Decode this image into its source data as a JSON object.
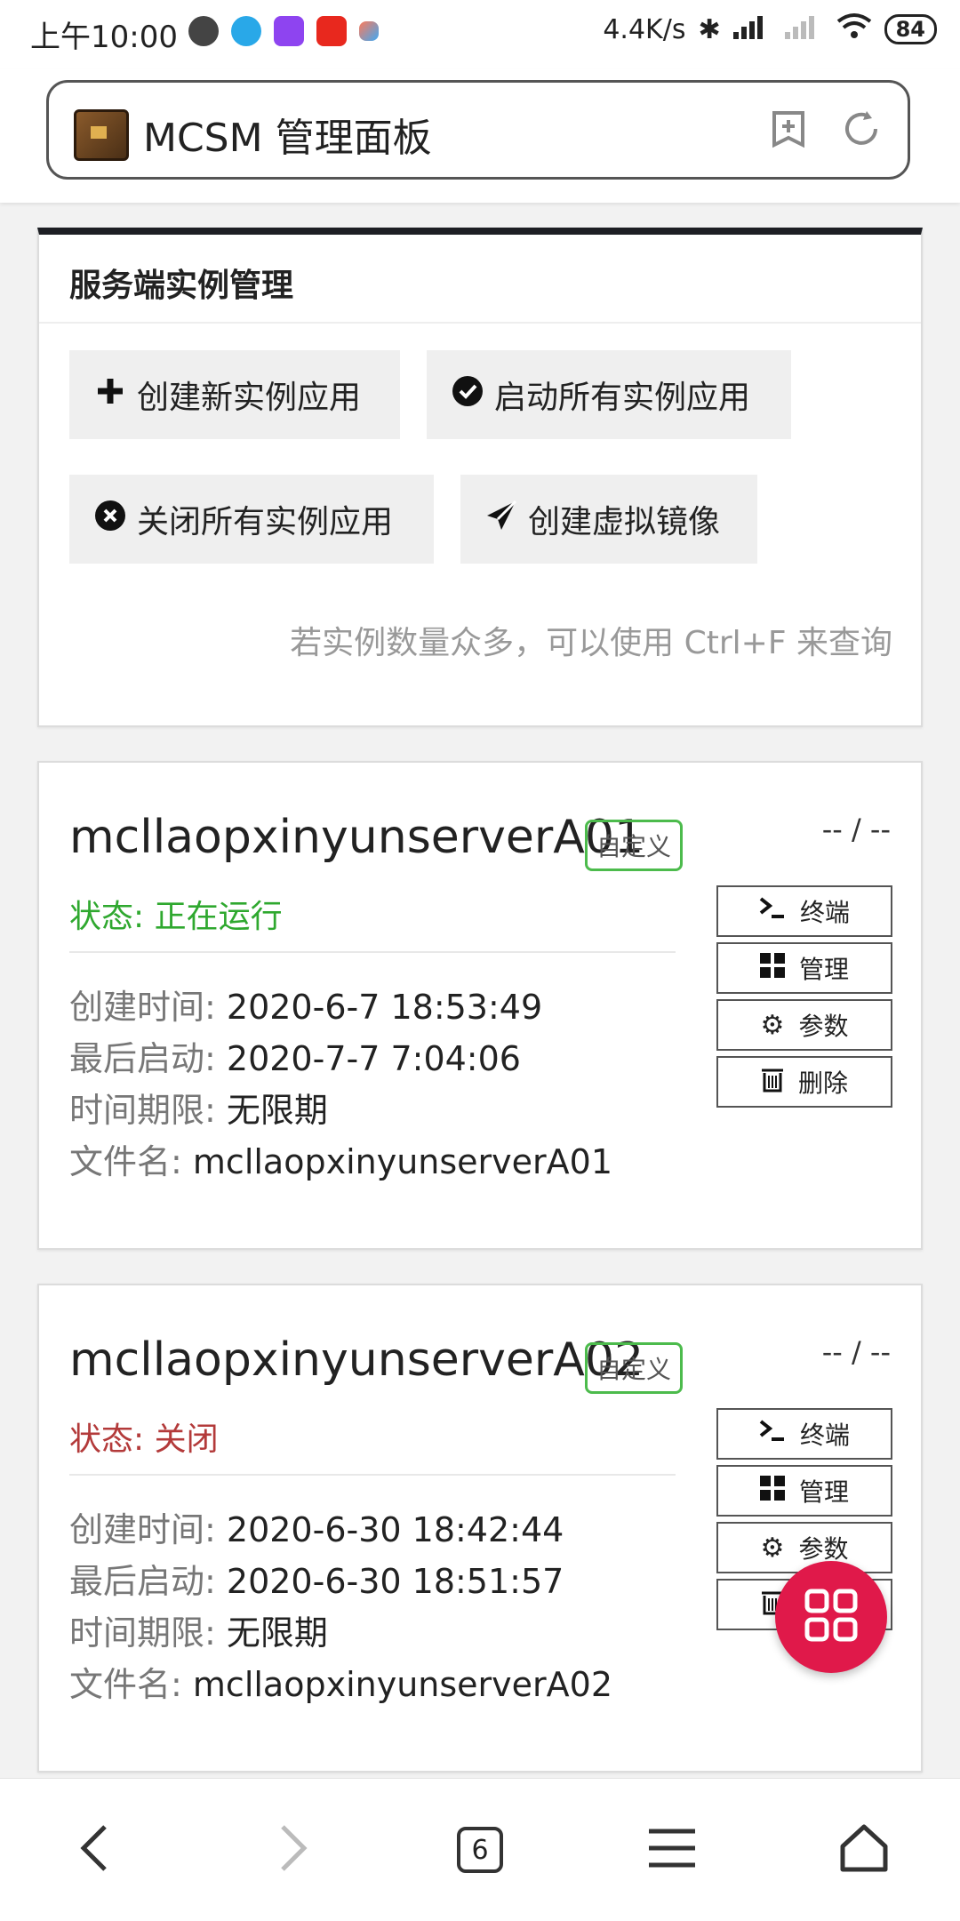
{
  "status_bar": {
    "time": "上午10:00",
    "net_speed": "4.4K/s",
    "battery": "84"
  },
  "address_bar": {
    "title": "MCSM 管理面板"
  },
  "management": {
    "title": "服务端实例管理",
    "buttons": {
      "create": "创建新实例应用",
      "start_all": "启动所有实例应用",
      "stop_all": "关闭所有实例应用",
      "create_image": "创建虚拟镜像"
    },
    "tip": "若实例数量众多，可以使用 Ctrl+F 来查询"
  },
  "instances": [
    {
      "name": "mcllaopxinyunserverA01",
      "badge": "自定义",
      "usage": "-- / --",
      "status": "状态: 正在运行",
      "created_label": "创建时间:",
      "created": "2020-6-7 18:53:49",
      "last_start_label": "最后启动:",
      "last_start": "2020-7-7 7:04:06",
      "limit_label": "时间期限:",
      "limit": "无限期",
      "file_label": "文件名:",
      "file": "mcllaopxinyunserverA01",
      "actions": {
        "terminal": "终端",
        "manage": "管理",
        "params": "参数",
        "delete": "删除"
      }
    },
    {
      "name": "mcllaopxinyunserverA02",
      "badge": "自定义",
      "usage": "-- / --",
      "status": "状态: 关闭",
      "created_label": "创建时间:",
      "created": "2020-6-30 18:42:44",
      "last_start_label": "最后启动:",
      "last_start": "2020-6-30 18:51:57",
      "limit_label": "时间期限:",
      "limit": "无限期",
      "file_label": "文件名:",
      "file": "mcllaopxinyunserverA02",
      "actions": {
        "terminal": "终端",
        "manage": "管理",
        "params": "参数",
        "delete": "删除"
      }
    }
  ],
  "browser_nav": {
    "tab_count": "6"
  },
  "colors": {
    "running": "#2fa82f",
    "stopped": "#b33a3a",
    "fab": "#e0194a",
    "badge_border": "#4cbb4c"
  }
}
